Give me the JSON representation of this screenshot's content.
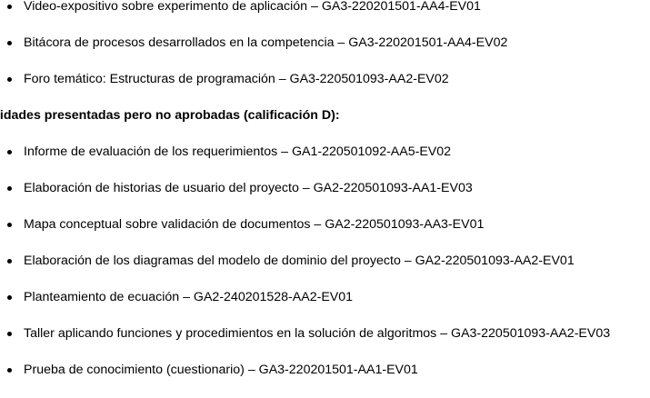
{
  "document": {
    "list_top": [
      "Video-expositivo sobre experimento de aplicación – GA3-220201501-AA4-EV01",
      "Bitácora de procesos desarrollados en la competencia – GA3-220201501-AA4-EV02",
      "Foro temático: Estructuras de programación – GA3-220501093-AA2-EV02"
    ],
    "section_heading": "vidades presentadas pero no aprobadas (calificación D):",
    "list_bottom": [
      "Informe de evaluación de los requerimientos – GA1-220501092-AA5-EV02",
      "Elaboración de historias de usuario del proyecto – GA2-220501093-AA1-EV03",
      "Mapa conceptual sobre validación de documentos – GA2-220501093-AA3-EV01",
      "Elaboración de los diagramas del modelo de dominio del proyecto – GA2-220501093-AA2-EV01",
      "Planteamiento de ecuación – GA2-240201528-AA2-EV01",
      "Taller aplicando funciones y procedimientos en la solución de algoritmos – GA3-220501093-AA2-EV03",
      "Prueba de conocimiento (cuestionario) – GA3-220201501-AA1-EV01"
    ]
  }
}
